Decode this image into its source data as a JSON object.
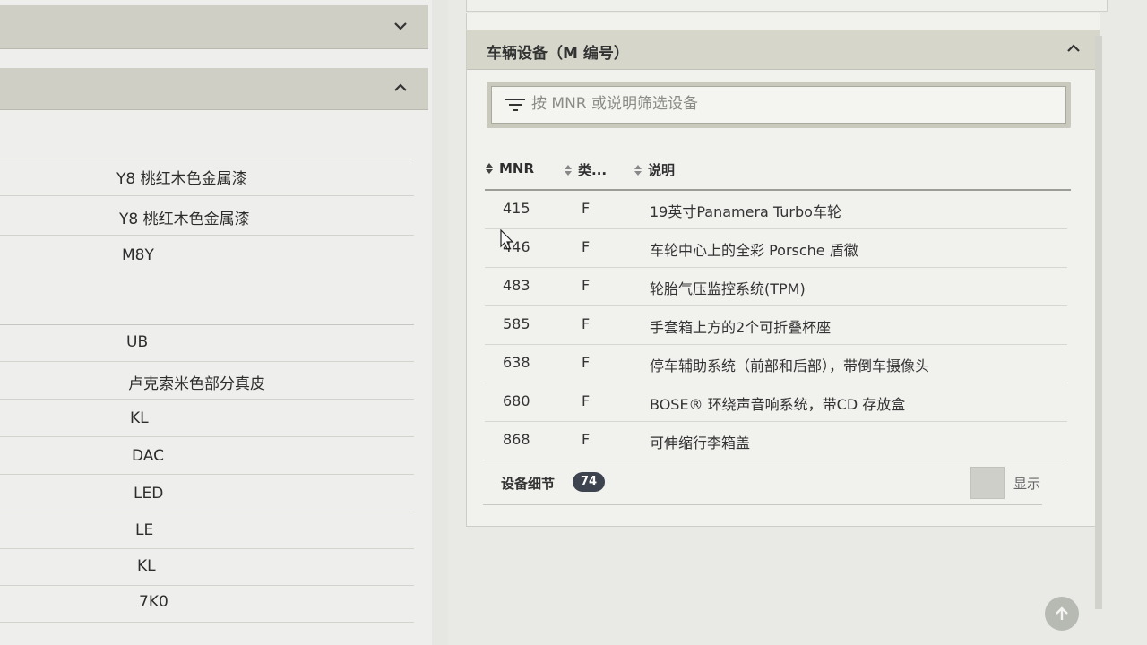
{
  "left_panel": {
    "rows_group_1": [
      "Y8 桃红木色金属漆",
      "Y8 桃红木色金属漆",
      "M8Y"
    ],
    "rows_group_2": [
      "UB",
      "卢克索米色部分真皮",
      "KL",
      "DAC",
      "LED",
      "LE",
      "KL",
      "7K0"
    ]
  },
  "equipment_panel": {
    "title": "车辆设备（M 编号）",
    "filter_placeholder": "按 MNR 或说明筛选设备",
    "columns": {
      "mnr": "MNR",
      "type": "类...",
      "description": "说明"
    },
    "rows": [
      {
        "mnr": "415",
        "type": "F",
        "description": "19英寸Panamera Turbo车轮"
      },
      {
        "mnr": "446",
        "type": "F",
        "description": "车轮中心上的全彩 Porsche 盾徽"
      },
      {
        "mnr": "483",
        "type": "F",
        "description": "轮胎气压监控系统(TPM)"
      },
      {
        "mnr": "585",
        "type": "F",
        "description": "手套箱上方的2个可折叠杯座"
      },
      {
        "mnr": "638",
        "type": "F",
        "description": "停车辅助系统（前部和后部），带倒车摄像头"
      },
      {
        "mnr": "680",
        "type": "F",
        "description": "BOSE® 环绕声音响系统，带CD 存放盒"
      },
      {
        "mnr": "868",
        "type": "F",
        "description": "可伸缩行李箱盖"
      }
    ],
    "details_label": "设备细节",
    "details_count": "74",
    "show_label": "显示"
  },
  "icons": {
    "chevron_collapsed": "chevron-down-icon",
    "chevron_expanded": "chevron-up-icon",
    "filter": "filter-lines-icon",
    "sort": "sort-arrows-icon",
    "scroll_top": "arrow-up-icon"
  },
  "colors": {
    "header_bg": "#d6d6cb",
    "badge_bg": "#3d4450",
    "panel_bg": "#f1f1ee"
  }
}
